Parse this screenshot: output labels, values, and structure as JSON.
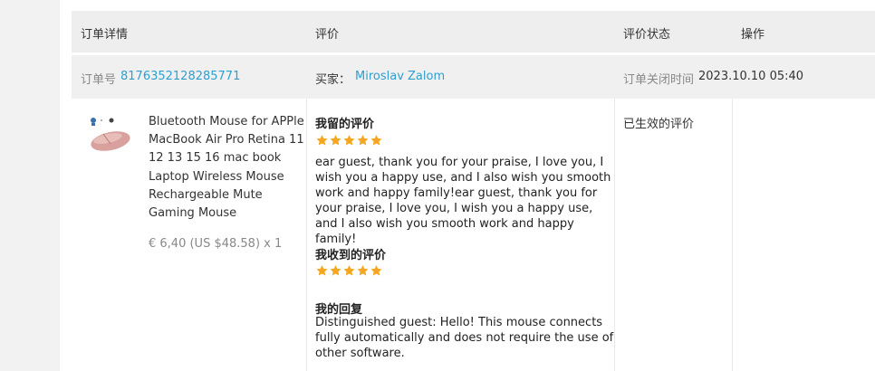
{
  "header": {
    "col_order": "订单详情",
    "col_review": "评价",
    "col_status": "评价状态",
    "col_action": "操作"
  },
  "order": {
    "number_label": "订单号",
    "number": "8176352128285771",
    "buyer_label": "买家：",
    "buyer_name": "Miroslav Zalom",
    "closed_label": "订单关闭时间",
    "closed_time": "2023.10.10 05:40"
  },
  "product": {
    "title": "Bluetooth Mouse for APPle MacBook Air Pro Retina 11 12 13 15 16 mac book Laptop Wireless Mouse Rechargeable Mute Gaming Mouse",
    "price": "€ 6,40 (US $48.58) x 1",
    "icon": "mouse-thumbnail"
  },
  "review": {
    "my_review_title": "我留的评价",
    "my_rating": 5,
    "my_review_text": "ear guest, thank you for your praise, I love you, I wish you a happy use, and I also wish you smooth work and happy family!ear guest, thank you for your praise, I love you, I wish you a happy use, and I also wish you smooth work and happy family!",
    "received_title": "我收到的评价",
    "received_rating": 5,
    "reply_title": "我的回复",
    "reply_text": "Distinguished guest: Hello! This mouse connects fully automatically and does not require the use of other software."
  },
  "status": {
    "text": "已生效的评价"
  },
  "colors": {
    "accent_link": "#2e9fd1",
    "star": "#f5a623",
    "header_bg": "#eeeeee"
  }
}
